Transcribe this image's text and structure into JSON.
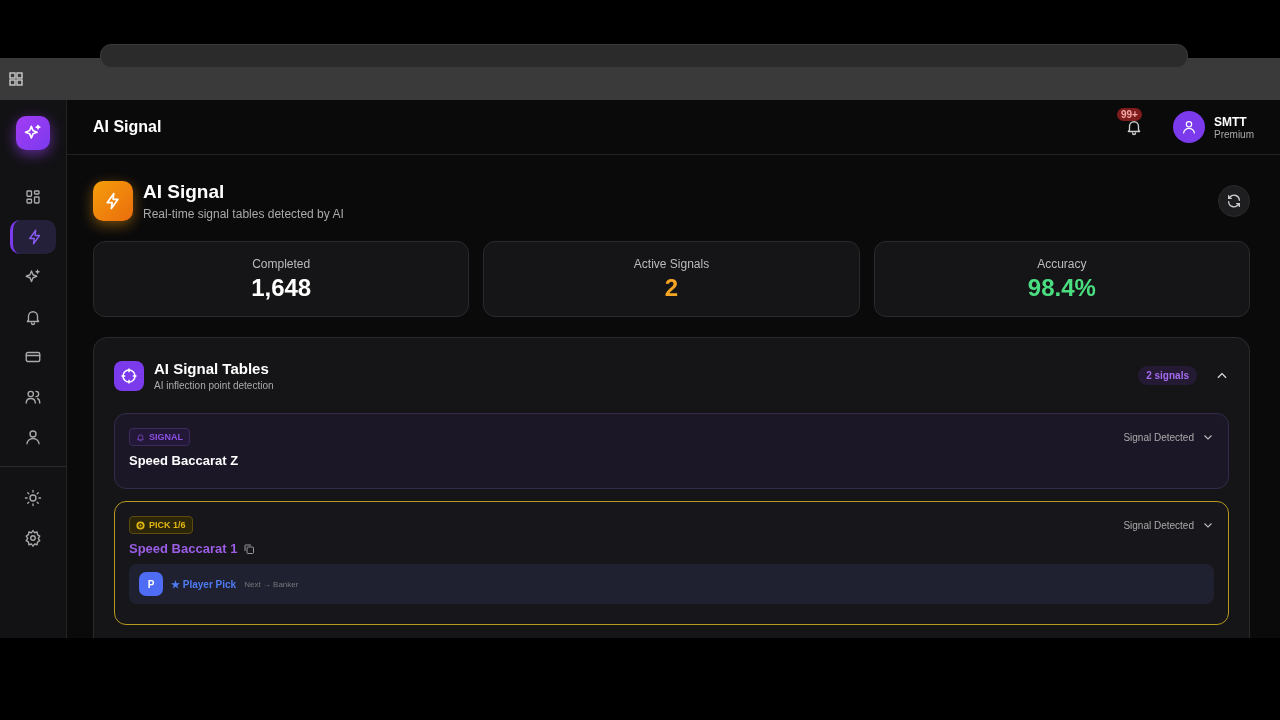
{
  "sidebar": {
    "items": [
      {
        "selected": false
      },
      {
        "selected": true
      },
      {
        "selected": false
      },
      {
        "selected": false
      },
      {
        "selected": false
      },
      {
        "selected": false
      },
      {
        "selected": false
      }
    ],
    "bottom_items": [
      {
        "selected": false
      },
      {
        "selected": false
      }
    ]
  },
  "header": {
    "title": "AI Signal",
    "notification_badge": "99+",
    "user": {
      "name": "SMTT",
      "plan": "Premium"
    }
  },
  "page": {
    "title": "AI Signal",
    "subtitle": "Real-time signal tables detected by AI"
  },
  "stats": [
    {
      "label": "Completed",
      "value": "1,648",
      "color": "#ffffff"
    },
    {
      "label": "Active Signals",
      "value": "2",
      "color": "#f5a524"
    },
    {
      "label": "Accuracy",
      "value": "98.4%",
      "color": "#4ade80"
    }
  ],
  "tables_panel": {
    "title": "AI Signal Tables",
    "subtitle": "AI inflection point detection",
    "count": "2 signals",
    "expanded": true,
    "signals": [
      {
        "kind": "signal",
        "badge": "SIGNAL",
        "name": "Speed Baccarat Z",
        "status": "Signal Detected"
      },
      {
        "kind": "pick",
        "badge": "PICK 1/6",
        "name": "Speed Baccarat 1",
        "status": "Signal Detected",
        "pick": {
          "avatar": "P",
          "label": "★ Player Pick",
          "next": "Next → Banker"
        }
      }
    ]
  }
}
